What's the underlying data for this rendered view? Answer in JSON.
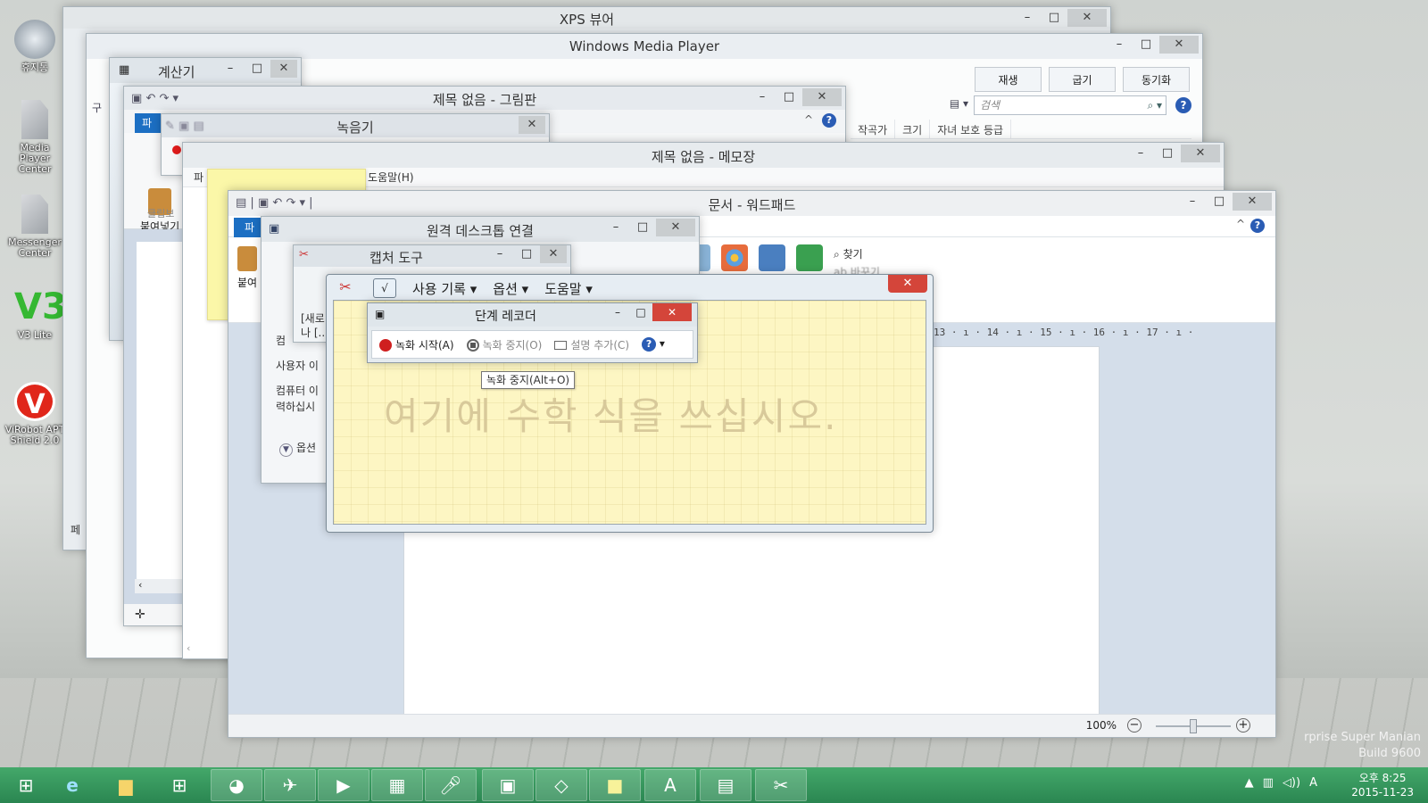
{
  "desktop": {
    "icons": [
      {
        "label": "휴지통",
        "icon": "recycle-bin-icon"
      },
      {
        "label": "Media Player Center",
        "icon": "document-icon"
      },
      {
        "label": "Messenger Center",
        "icon": "document-icon"
      },
      {
        "label": "V3 Lite",
        "icon": "v3-icon"
      },
      {
        "label": "ViRobot APT Shield 2.0",
        "icon": "virobot-icon"
      }
    ],
    "watermark_line1": "rprise Super Manian",
    "watermark_line2": "Build 9600"
  },
  "windows": {
    "xps": {
      "title": "XPS 뷰어",
      "status": "페"
    },
    "wmp": {
      "title": "Windows Media Player",
      "tabs": [
        "재생",
        "굽기",
        "동기화"
      ],
      "search_placeholder": "검색",
      "columns": [
        "작곡가",
        "크기",
        "자녀 보호 등급"
      ],
      "nav_label": "구",
      "help": "?"
    },
    "calc": {
      "title": "계산기"
    },
    "paint": {
      "title": "제목 없음 - 그림판",
      "file_tab": "파",
      "paste_label": "붙여넣기",
      "group_label": "클립보",
      "help": "?"
    },
    "recorder": {
      "title": "녹음기"
    },
    "notepad": {
      "title": "제목 없음 - 메모장",
      "menu_help": "도움말(H)",
      "menu_file": "파"
    },
    "wordpad": {
      "title": "문서 - 워드패드",
      "file_tab": "파",
      "paste_label": "붙여",
      "find_label": "찾기",
      "replace_label": "바꾸기",
      "ruler": "13 · ı · 14 · ı · 15 · ı · 16 · ı · 17 · ı ·",
      "zoom": "100%",
      "help": "?"
    },
    "rdp": {
      "title": "원격 데스크톱 연결",
      "line_computer": "컴",
      "line_user": "사용자 이",
      "line_help1": "컴퓨터 이",
      "line_help2": "력하십시",
      "options": "옵션"
    },
    "snip": {
      "title": "캡처 도구",
      "text1": "[새로",
      "text2": "나 [..."
    },
    "math": {
      "menu": [
        "사용 기록",
        "옵션",
        "도움말"
      ],
      "placeholder": "여기에 수학 식을 쓰십시오."
    },
    "psr": {
      "title": "단계 레코더",
      "start": "녹화 시작(A)",
      "stop": "녹화 중지(O)",
      "comment": "설명 추가(C)",
      "tooltip": "녹화 중지(Alt+O)"
    }
  },
  "taskbar": {
    "time": "오후 8:25",
    "date": "2015-11-23",
    "ime": "A",
    "buttons": [
      "start-icon",
      "ie-icon",
      "explorer-icon",
      "store-icon",
      "paint-icon",
      "xps-icon",
      "media-player-icon",
      "calculator-icon",
      "microphone-icon",
      "snipping-icon",
      "math-icon",
      "sticky-notes-icon",
      "wordpad-icon",
      "remote-desktop-icon",
      "snip-tool-icon"
    ]
  }
}
